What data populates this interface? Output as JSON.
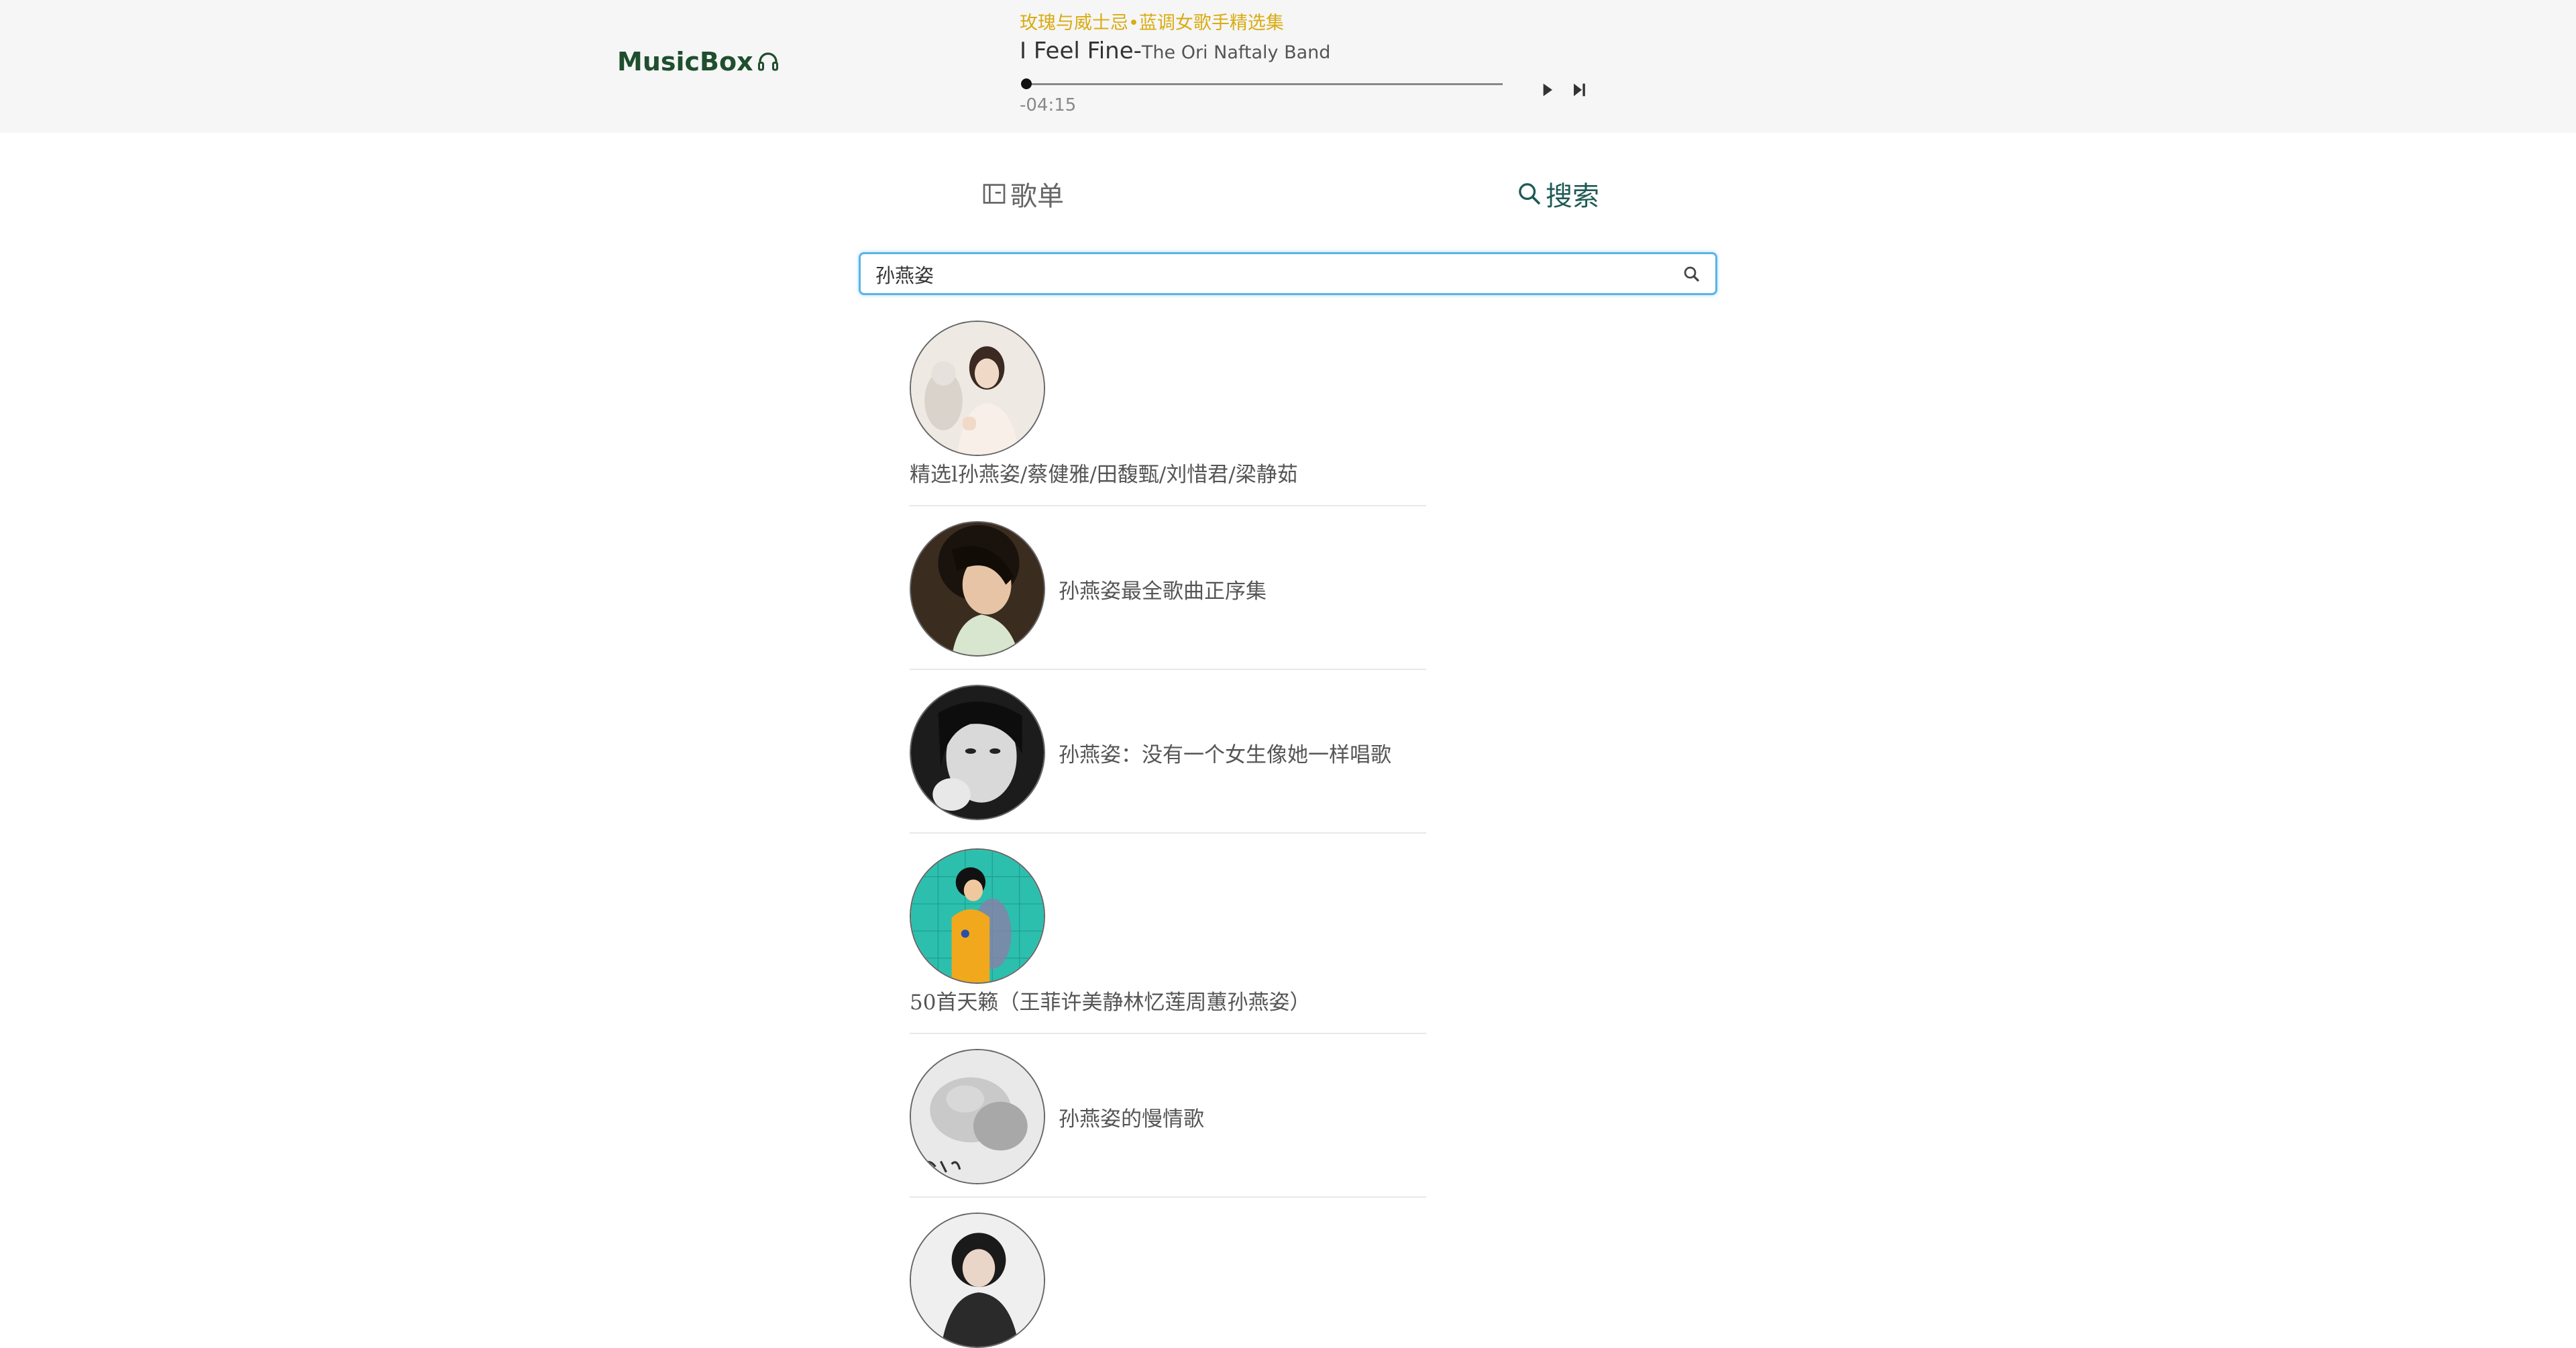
{
  "header": {
    "logo_text": "MusicBox",
    "logo_icon": "headphones-icon"
  },
  "player": {
    "playlist_name": "玫瑰与威士忌•蓝调女歌手精选集",
    "song_title": "I Feel Fine",
    "separator": "-",
    "artist": "The Ori Naftaly Band",
    "time_remaining": "-04:15",
    "progress": 0.0,
    "controls": [
      "play-icon",
      "skip-next-icon"
    ]
  },
  "tabs": [
    {
      "label": "歌单",
      "icon": "playlist-icon",
      "active": false
    },
    {
      "label": "搜索",
      "icon": "search-icon",
      "active": true
    }
  ],
  "search": {
    "value": "孙燕姿",
    "placeholder": ""
  },
  "results": [
    {
      "title": "精选l孙燕姿/蔡健雅/田馥甄/刘惜君/梁静茹"
    },
    {
      "title": "孙燕姿最全歌曲正序集"
    },
    {
      "title": "孙燕姿：没有一个女生像她一样唱歌"
    },
    {
      "title": "50首天籁（王菲许美静林忆莲周蕙孙燕姿）"
    },
    {
      "title": "孙燕姿的慢情歌"
    },
    {
      "title": ""
    }
  ],
  "colors": {
    "header_bg": "#f6f6f6",
    "logo": "#1f4f2e",
    "playlist_name": "#d9ac12",
    "active_tab": "#1f5a55",
    "search_border": "#59b4e8"
  }
}
